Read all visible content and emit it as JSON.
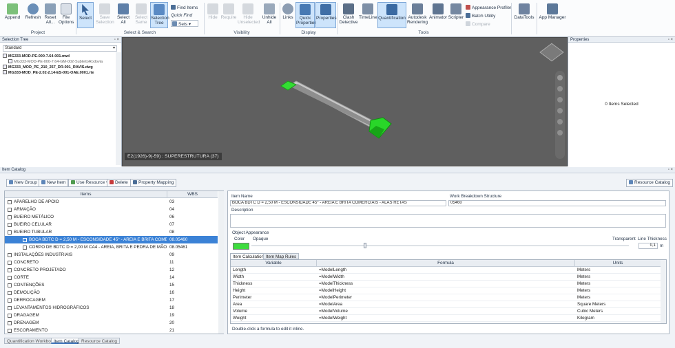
{
  "ribbon": {
    "project": {
      "label": "Project",
      "append": "Append",
      "refresh": "Refresh",
      "reset_all": "Reset All...",
      "file_options": "File Options"
    },
    "select_search": {
      "label": "Select & Search",
      "select": "Select",
      "save_selection": "Save Selection",
      "select_all": "Select All",
      "select_same": "Select Same",
      "selection_tree": "Selection Tree",
      "find_items": "Find Items",
      "quick_find": "Quick Find",
      "sets": "Sets"
    },
    "visibility": {
      "label": "Visibility",
      "hide": "Hide",
      "require": "Require",
      "hide_unselected": "Hide Unselected",
      "unhide_all": "Unhide All"
    },
    "display": {
      "label": "Display",
      "links": "Links",
      "quick_properties": "Quick Properties",
      "properties": "Properties"
    },
    "tools": {
      "label": "Tools",
      "clash_detective": "Clash Detective",
      "timeliner": "TimeLiner",
      "quantification": "Quantification",
      "autodesk_rendering": "Autodesk Rendering",
      "animator": "Animator",
      "scripter": "Scripter",
      "appearance_profiler": "Appearance Profiler",
      "batch_utility": "Batch Utility",
      "compare": "Compare"
    },
    "datatools": "DataTools",
    "app_manager": "App Manager"
  },
  "selection_tree": {
    "title": "Selection Tree",
    "mode": "Standard",
    "items": [
      "MG333-MOD-PE-000-7.64-001.nwd",
      "MG333-MOD-PE-000-7.64-GM-002-SubleitoRodovia",
      "MG333_MOD_PE_210_257_DR-001_RAVIS.dwg",
      "MG333-MOD_PE-2.02-2.14-ES-001-OAE.0001.rte"
    ]
  },
  "viewport": {
    "status_label": "E2(1926)-9(-59) : SUPERESTRUTURA (37)"
  },
  "properties": {
    "title": "Properties",
    "empty_text": "0 Items Selected"
  },
  "catalog": {
    "title": "Item Catalog",
    "toolbar": {
      "new_group": "New Group",
      "new_item": "New Item",
      "use_resource": "Use Resource",
      "delete": "Delete",
      "property_mapping": "Property Mapping",
      "resource_catalog": "Resource Catalog"
    },
    "columns": {
      "items": "Items",
      "wbs": "WBS"
    },
    "rows": [
      {
        "name": "APARELHO DE APOIO",
        "wbs": "03",
        "level": 0
      },
      {
        "name": "ARMAÇÃO",
        "wbs": "04",
        "level": 0
      },
      {
        "name": "BUEIRO METÁLICO",
        "wbs": "06",
        "level": 0
      },
      {
        "name": "BUEIRO CELULAR",
        "wbs": "07",
        "level": 0
      },
      {
        "name": "BUEIRO TUBULAR",
        "wbs": "08",
        "level": 0
      },
      {
        "name": "BOCA BDTC D = 2,50 M - ESCONSIDADE 45° - AREIA E BRITA COMERCIAIS",
        "wbs": "08.05460",
        "level": 1,
        "selected": true
      },
      {
        "name": "CORPO DE BDTC D = 2,00 M CA4 - AREIA, BRITA E PEDRA DE MÃO COMERCIAIS",
        "wbs": "08.05461",
        "level": 1
      },
      {
        "name": "INSTALAÇÕES INDUSTRIAIS",
        "wbs": "09",
        "level": 0
      },
      {
        "name": "CONCRETO",
        "wbs": "11",
        "level": 0
      },
      {
        "name": "CONCRETO PROJETADO",
        "wbs": "12",
        "level": 0
      },
      {
        "name": "CORTE",
        "wbs": "14",
        "level": 0
      },
      {
        "name": "CONTENÇÕES",
        "wbs": "15",
        "level": 0
      },
      {
        "name": "DEMOLIÇÃO",
        "wbs": "16",
        "level": 0
      },
      {
        "name": "DERROCAGEM",
        "wbs": "17",
        "level": 0
      },
      {
        "name": "LEVANTAMENTOS HIDROGRÁFICOS",
        "wbs": "18",
        "level": 0
      },
      {
        "name": "DRAGAGEM",
        "wbs": "19",
        "level": 0
      },
      {
        "name": "DRENAGEM",
        "wbs": "20",
        "level": 0
      },
      {
        "name": "ESCORAMENTO",
        "wbs": "21",
        "level": 0
      }
    ],
    "detail": {
      "item_name_label": "Item Name",
      "item_name": "BOCA BDTC D = 2,50 M - ESCONSIDADE 45° - AREIA E BRITA COMERCIAIS - ALAS RETAS",
      "wbs_label": "Work Breakdown Structure",
      "wbs": "05460",
      "description_label": "Description",
      "object_appearance_label": "Object Appearance",
      "color_label": "Color",
      "opaque_label": "Opaque",
      "transparent_label": "Transparent",
      "line_thickness_label": "Line Thickness",
      "line_thickness": "0,1",
      "line_unit": "m",
      "swatch_color": "#3ddc3d",
      "tab_item_calculations": "Item Calculations",
      "tab_item_map_rules": "Item Map Rules",
      "calc_columns": {
        "variable": "Variable",
        "formula": "Formula",
        "units": "Units"
      },
      "calc_rows": [
        {
          "variable": "Length",
          "formula": "=ModelLength",
          "units": "Meters"
        },
        {
          "variable": "Width",
          "formula": "=ModelWidth",
          "units": "Meters"
        },
        {
          "variable": "Thickness",
          "formula": "=ModelThickness",
          "units": "Meters"
        },
        {
          "variable": "Height",
          "formula": "=ModelHeight",
          "units": "Meters"
        },
        {
          "variable": "Perimeter",
          "formula": "=ModelPerimeter",
          "units": "Meters"
        },
        {
          "variable": "Area",
          "formula": "=ModelArea",
          "units": "Square Meters"
        },
        {
          "variable": "Volume",
          "formula": "=ModelVolume",
          "units": "Cubic Meters"
        },
        {
          "variable": "Weight",
          "formula": "=ModelWeight",
          "units": "Kilogram"
        }
      ],
      "hint": "Double-click a formula to edit it inline."
    }
  },
  "bottom_tabs": [
    "Quantification Workbook",
    "Item Catalog",
    "Resource Catalog"
  ]
}
